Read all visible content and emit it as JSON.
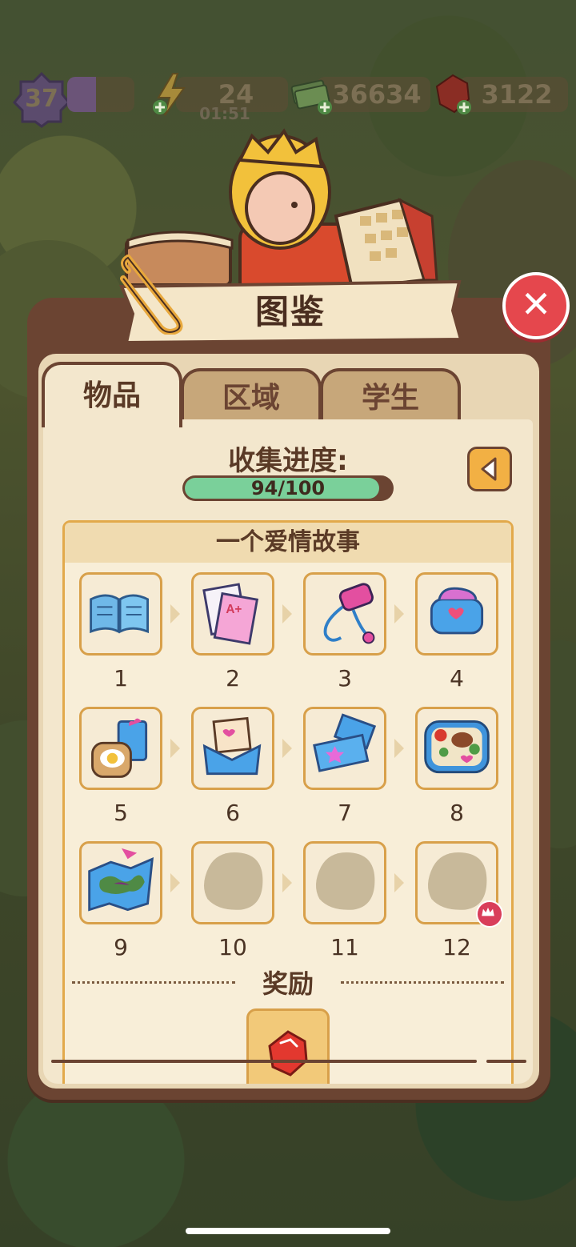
{
  "hud": {
    "level": "37",
    "energy": "24",
    "energy_timer": "01:51",
    "cash": "36634",
    "gems": "3122"
  },
  "panel": {
    "title": "图鉴",
    "tabs": [
      {
        "label": "物品",
        "active": true
      },
      {
        "label": "区域",
        "active": false
      },
      {
        "label": "学生",
        "active": false
      }
    ],
    "progress_label": "收集进度:",
    "progress_text": "94/100",
    "progress_fraction": 0.94,
    "story_title": "一个爱情故事",
    "items": [
      {
        "number": "1",
        "icon": "open-book-icon",
        "unlocked": true
      },
      {
        "number": "2",
        "icon": "graded-papers-icon",
        "unlocked": true
      },
      {
        "number": "3",
        "icon": "music-player-icon",
        "unlocked": true
      },
      {
        "number": "4",
        "icon": "lunch-bag-icon",
        "unlocked": true
      },
      {
        "number": "5",
        "icon": "milk-and-toast-icon",
        "unlocked": true
      },
      {
        "number": "6",
        "icon": "love-letter-icon",
        "unlocked": true
      },
      {
        "number": "7",
        "icon": "movie-tickets-icon",
        "unlocked": true
      },
      {
        "number": "8",
        "icon": "bento-box-icon",
        "unlocked": true
      },
      {
        "number": "9",
        "icon": "treasure-map-icon",
        "unlocked": true
      },
      {
        "number": "10",
        "icon": "locked-silhouette-icon",
        "unlocked": false
      },
      {
        "number": "11",
        "icon": "locked-silhouette-icon",
        "unlocked": false
      },
      {
        "number": "12",
        "icon": "locked-silhouette-icon",
        "unlocked": false
      }
    ],
    "reward_label": "奖励"
  },
  "colors": {
    "panel_border": "#6b4432",
    "panel_bg": "#f3e7cd",
    "progress_fill": "#7ad09a",
    "close_red": "#e5474d",
    "back_orange": "#f2b044"
  }
}
